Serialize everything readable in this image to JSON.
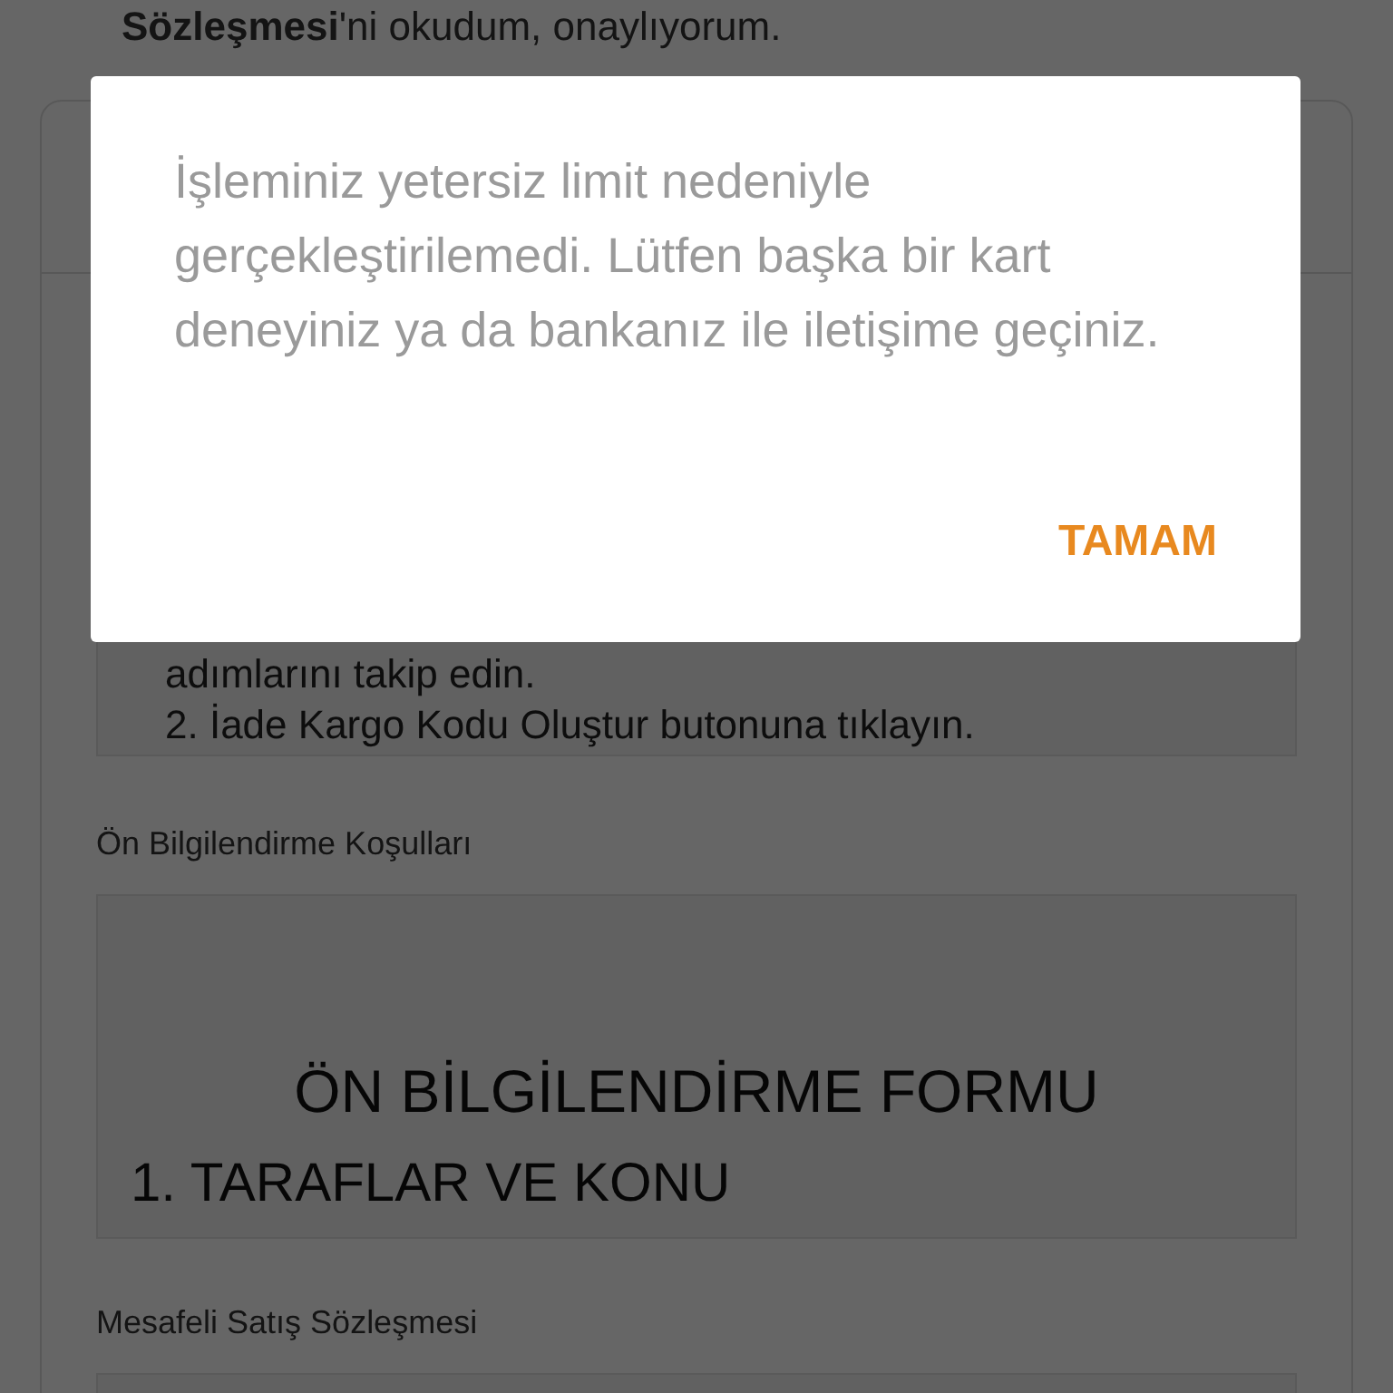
{
  "background": {
    "consent_text": "**Sözleşmesi**'ni okudum, onaylıyorum.",
    "return_steps": [
      "adımlarını takip edin.",
      "2. İade Kargo Kodu Oluştur butonuna tıklayın."
    ],
    "sections": [
      {
        "title": "Ön Bilgilendirme Koşulları",
        "heading": "ÖN BİLGİLENDİRME FORMU",
        "subheading": "1. TARAFLAR VE KONU"
      },
      {
        "title": "Mesafeli Satış Sözleşmesi"
      }
    ]
  },
  "dialog": {
    "message": "İşleminiz yetersiz limit nedeniyle gerçekleştirilemedi. Lütfen başka bir kart deneyiniz ya da bankanız ile iletişime geçiniz.",
    "button": "TAMAM"
  }
}
